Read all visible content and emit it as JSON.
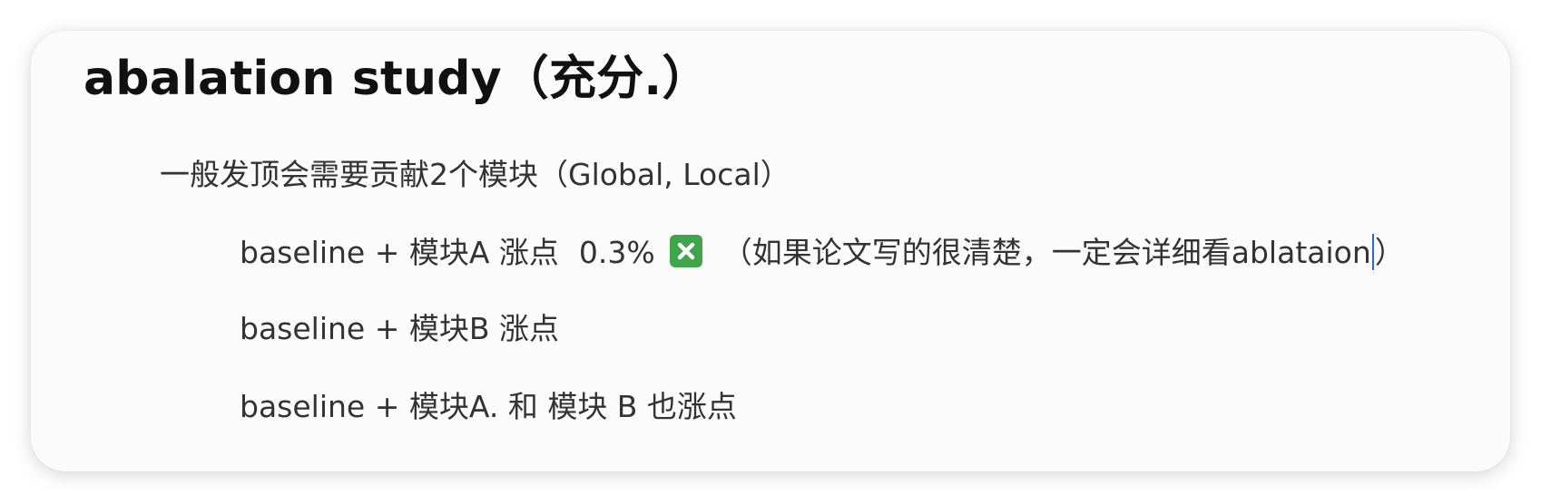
{
  "title": "abalation study（充分.）",
  "lines": {
    "intro": "一般发顶会需要贡献2个模块（Global, Local）",
    "row_a": {
      "prefix": "baseline + 模块A 涨点",
      "value": "0.3%",
      "note_main": "（如果论文写的很清楚，一定会详细看ablataion",
      "note_close": "）"
    },
    "row_b": "baseline + 模块B 涨点",
    "row_ab": "baseline + 模块A. 和 模块 B 也涨点"
  },
  "icons": {
    "cross_mark": "cross-mark-button-icon"
  },
  "colors": {
    "cross_mark_bg": "#3fa44a",
    "caret": "#2f66d4"
  }
}
